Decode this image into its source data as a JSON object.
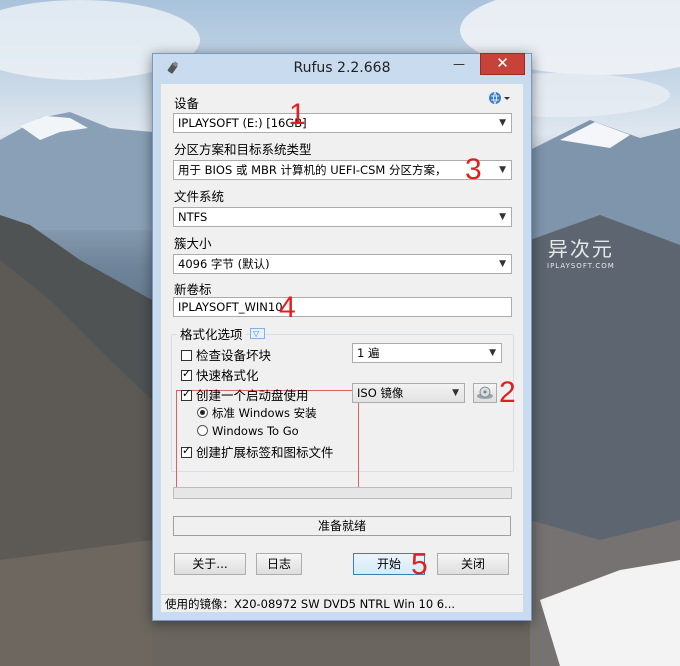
{
  "window": {
    "title": "Rufus 2.2.668",
    "minimize": "—",
    "maximize": "□",
    "close": "✕"
  },
  "device": {
    "label": "设备",
    "value": "IPLAYSOFT (E:) [16GB]",
    "lang_icon": "language-icon"
  },
  "partition": {
    "label": "分区方案和目标系统类型",
    "value": "用于 BIOS 或 MBR 计算机的 UEFI-CSM 分区方案，"
  },
  "filesystem": {
    "label": "文件系统",
    "value": "NTFS"
  },
  "cluster": {
    "label": "簇大小",
    "value": "4096 字节 (默认)"
  },
  "volume": {
    "label": "新卷标",
    "value": "IPLAYSOFT_WIN10"
  },
  "format_options": {
    "title": "格式化选项",
    "check_bad_blocks": {
      "label": "检查设备坏块",
      "checked": false
    },
    "passes": "1 遍",
    "quick_format": {
      "label": "快速格式化",
      "checked": true
    },
    "bootable": {
      "label": "创建一个启动盘使用",
      "checked": true
    },
    "boot_type": "ISO 镜像",
    "radio_standard": {
      "label": "标准 Windows 安装",
      "selected": true
    },
    "radio_wtg": {
      "label": "Windows To Go",
      "selected": false
    },
    "extended_label": {
      "label": "创建扩展标签和图标文件",
      "checked": true
    }
  },
  "status": "准备就绪",
  "buttons": {
    "about": "关于...",
    "log": "日志",
    "start": "开始",
    "close": "关闭"
  },
  "statusbar": "使用的镜像：X20-08972 SW DVD5 NTRL Win 10 6...",
  "annotations": [
    "1",
    "2",
    "3",
    "4",
    "5"
  ],
  "watermark": {
    "main": "异次元",
    "sub": "IPLAYSOFT.COM"
  },
  "colors": {
    "annotation_red": "#e02020",
    "title_bar": "#c9dbef",
    "close_button": "#c7433a"
  }
}
